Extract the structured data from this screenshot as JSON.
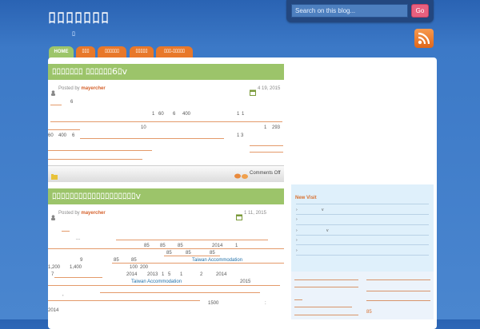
{
  "header": {
    "title": "ﾛﾛﾛﾛﾛﾛﾛ",
    "subtitle": "ﾛ"
  },
  "search": {
    "placeholder": "Search on this blog...",
    "button_label": "Go"
  },
  "nav": {
    "tabs": [
      {
        "label": "HOME"
      },
      {
        "label": "ﾛﾛﾛ"
      },
      {
        "label": "ﾛﾛﾛﾛﾛﾛ"
      },
      {
        "label": "ﾛﾛﾛﾛﾛ"
      },
      {
        "label": "ﾛﾛﾛ-ﾛﾛﾛﾛﾛ"
      }
    ]
  },
  "posts": [
    {
      "title": "ﾛﾛﾛﾛﾛﾛﾛ ﾛﾛﾛﾛﾛﾛ6ﾛv",
      "posted_by_label": "Posted by",
      "author": "mayercher",
      "date": "4 19, 2015",
      "body_fragments": [
        "6",
        "1",
        "60",
        "6",
        "400",
        "1",
        "1",
        "10",
        "1",
        "293",
        "60",
        "400",
        "6",
        "1 3"
      ],
      "comments_label": "Comments Off"
    },
    {
      "title": "ﾛﾛﾛﾛﾛﾛﾛﾛﾛﾛﾛﾛﾛﾛﾛﾛﾛﾛﾛv",
      "posted_by_label": "Posted by",
      "author": "mayercher",
      "date": "1 11, 2015",
      "body_fragments": [
        "...",
        "85",
        "85",
        "85",
        "2014",
        "1",
        "85",
        "85",
        "85",
        "9",
        "85",
        "85",
        "1,200",
        "1,400",
        "100",
        "200",
        "7",
        "2014",
        "2013",
        "1",
        "5",
        "1",
        "2",
        "2014",
        "2015",
        ",",
        "1500",
        ":",
        "2014"
      ],
      "links": [
        "Taiwan Accommodation",
        "Taiwan Accommodation"
      ]
    }
  ],
  "sidebar": {
    "widget_title": "New Visit",
    "items": [
      "v",
      "v"
    ],
    "footer_link": "85"
  }
}
